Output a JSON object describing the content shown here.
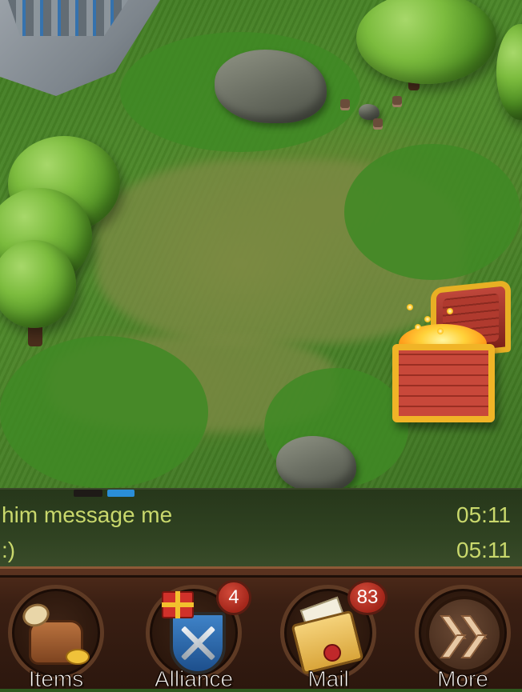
{
  "chat": {
    "messages": [
      {
        "text": "him message me",
        "time": "05:11"
      },
      {
        "text": ":)",
        "time": "05:11"
      }
    ]
  },
  "nav": {
    "items": {
      "label": "Items",
      "icon": "items-bag-icon"
    },
    "alliance": {
      "label": "Alliance",
      "icon": "alliance-shield-icon",
      "badge": "4"
    },
    "mail": {
      "label": "Mail",
      "icon": "mail-envelope-icon",
      "badge": "83"
    },
    "more": {
      "label": "More",
      "icon": "double-chevron-icon"
    }
  },
  "colors": {
    "chat_text": "#c9d86c",
    "badge": "#b32d1f",
    "bar": "#3a1f13",
    "chat_tab_active": "#2a8ed8"
  }
}
